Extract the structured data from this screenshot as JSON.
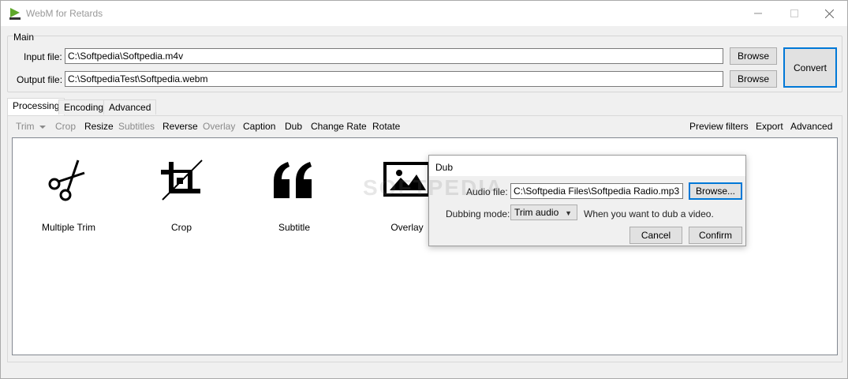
{
  "window": {
    "title": "WebM for Retards",
    "minimize": "—",
    "maximize": "☐",
    "close": "✕",
    "app_icon_label": "webm"
  },
  "main": {
    "group_label": "Main",
    "input_label": "Input file:",
    "input_value": "C:\\Softpedia\\Softpedia.m4v",
    "output_label": "Output file:",
    "output_value": "C:\\SoftpediaTest\\Softpedia.webm",
    "browse_label": "Browse",
    "convert_label": "Convert"
  },
  "tabs": [
    {
      "label": "Processing",
      "active": true
    },
    {
      "label": "Encoding",
      "active": false
    },
    {
      "label": "Advanced",
      "active": false
    }
  ],
  "toolbar": {
    "trim": "Trim",
    "crop": "Crop",
    "resize": "Resize",
    "subtitles": "Subtitles",
    "reverse": "Reverse",
    "overlay": "Overlay",
    "caption": "Caption",
    "dub": "Dub",
    "change_rate": "Change Rate",
    "rotate": "Rotate",
    "preview_filters": "Preview filters",
    "export": "Export",
    "advanced": "Advanced"
  },
  "tools": [
    {
      "label": "Multiple Trim",
      "icon": "scissors-icon"
    },
    {
      "label": "Crop",
      "icon": "crop-icon"
    },
    {
      "label": "Subtitle",
      "icon": "quote-icon"
    },
    {
      "label": "Overlay",
      "icon": "image-icon"
    }
  ],
  "dub_dialog": {
    "title": "Dub",
    "audio_label": "Audio file:",
    "audio_value": "C:\\Softpedia Files\\Softpedia Radio.mp3",
    "browse_label": "Browse...",
    "mode_label": "Dubbing mode:",
    "mode_value": "Trim audio",
    "mode_hint": "When you want to dub a video.",
    "cancel_label": "Cancel",
    "confirm_label": "Confirm"
  },
  "watermark": "SOFTPEDIA"
}
